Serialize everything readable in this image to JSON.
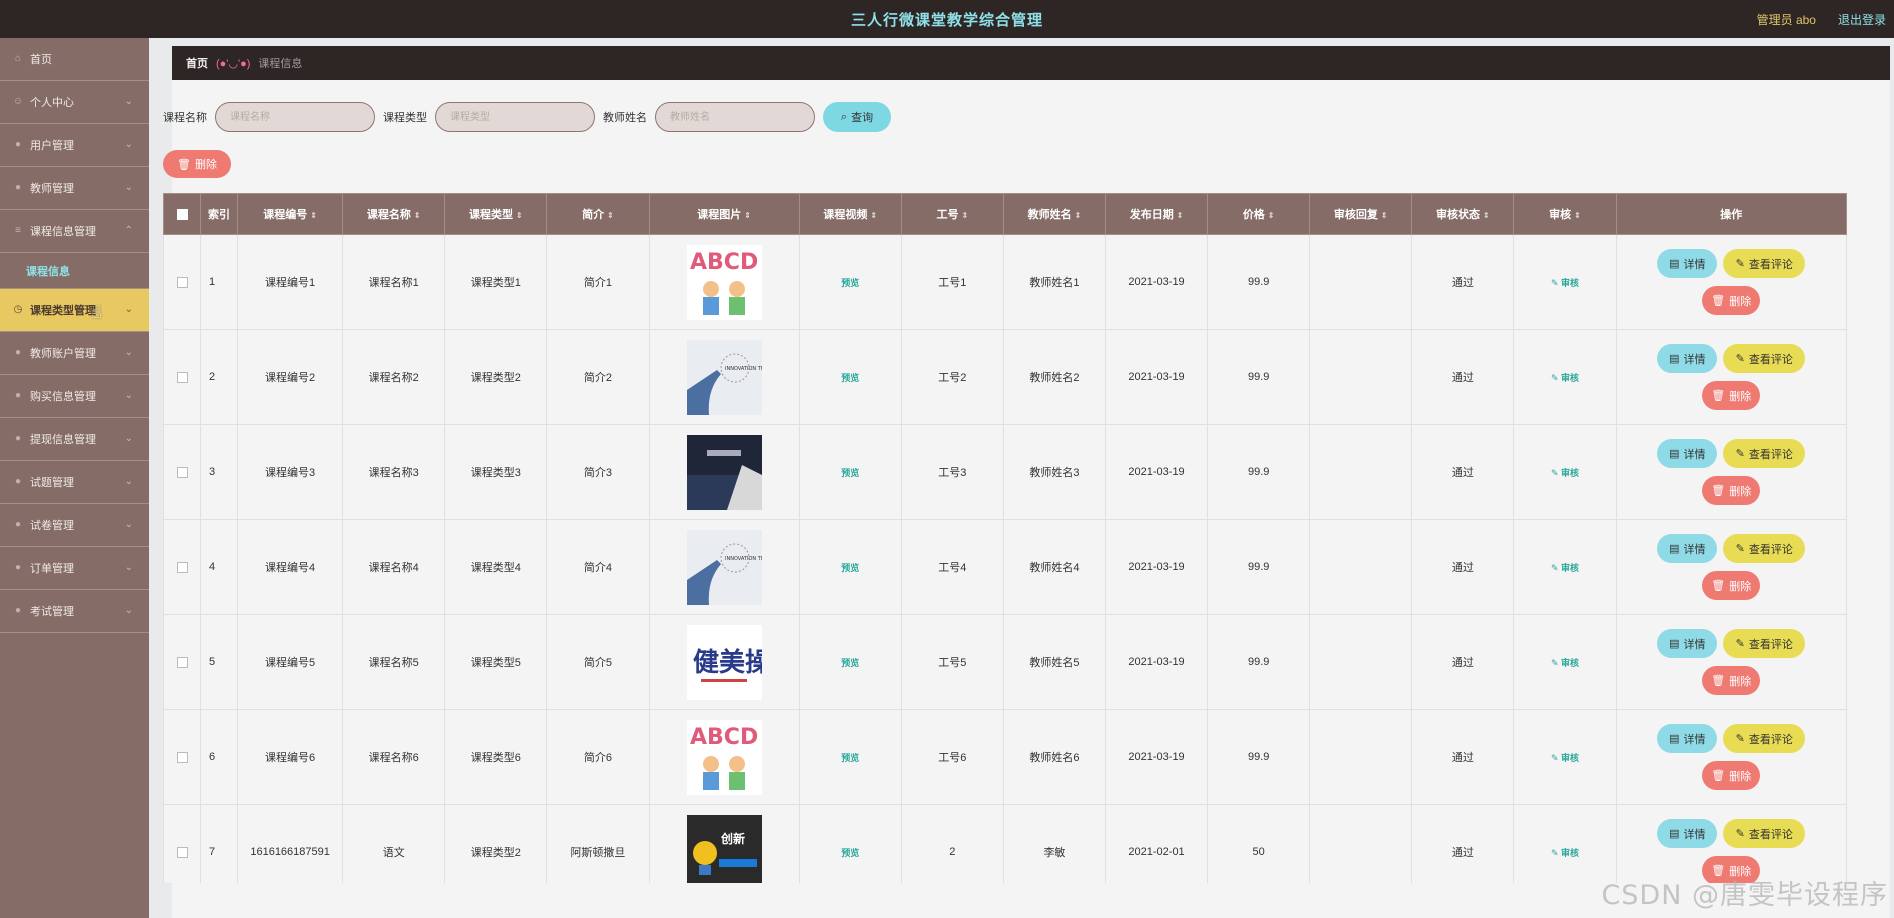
{
  "header": {
    "title": "三人行微课堂教学综合管理",
    "user_label": "管理员 abo",
    "logout_label": "退出登录"
  },
  "sidebar": {
    "items": [
      {
        "label": "首页",
        "icon": "home-icon"
      },
      {
        "label": "个人中心",
        "icon": "user-icon"
      },
      {
        "label": "用户管理",
        "icon": "users-icon"
      },
      {
        "label": "教师管理",
        "icon": "teacher-icon"
      },
      {
        "label": "课程信息管理",
        "icon": "course-icon"
      },
      {
        "label": "课程类型管理",
        "icon": "clock-icon"
      },
      {
        "label": "教师账户管理",
        "icon": "account-icon"
      },
      {
        "label": "购买信息管理",
        "icon": "cart-icon"
      },
      {
        "label": "提现信息管理",
        "icon": "wallet-icon"
      },
      {
        "label": "试题管理",
        "icon": "question-icon"
      },
      {
        "label": "试卷管理",
        "icon": "paper-icon"
      },
      {
        "label": "订单管理",
        "icon": "order-icon"
      },
      {
        "label": "考试管理",
        "icon": "exam-icon"
      }
    ],
    "sub_item": "课程信息",
    "active_color": "#e8c860"
  },
  "breadcrumb": {
    "home": "首页",
    "separator": "(●'◡'●)",
    "current": "课程信息"
  },
  "search": {
    "course_name_label": "课程名称",
    "course_name_placeholder": "课程名称",
    "course_type_label": "课程类型",
    "course_type_placeholder": "课程类型",
    "teacher_name_label": "教师姓名",
    "teacher_name_placeholder": "教师姓名",
    "query_label": "查询"
  },
  "batch_delete_label": "删除",
  "table": {
    "columns": [
      "索引",
      "课程编号",
      "课程名称",
      "课程类型",
      "简介",
      "课程图片",
      "课程视频",
      "工号",
      "教师姓名",
      "发布日期",
      "价格",
      "审核回复",
      "审核状态",
      "审核",
      "操作"
    ],
    "rows": [
      {
        "idx": "1",
        "code": "课程编号1",
        "name": "课程名称1",
        "type": "课程类型1",
        "intro": "简介1",
        "image": "abcd",
        "video": "预览",
        "job_no": "工号1",
        "teacher": "教师姓名1",
        "date": "2021-03-19",
        "price": "99.9",
        "reply": "",
        "status": "通过",
        "audit": "审核"
      },
      {
        "idx": "2",
        "code": "课程编号2",
        "name": "课程名称2",
        "type": "课程类型2",
        "intro": "简介2",
        "image": "hand",
        "video": "预览",
        "job_no": "工号2",
        "teacher": "教师姓名2",
        "date": "2021-03-19",
        "price": "99.9",
        "reply": "",
        "status": "通过",
        "audit": "审核"
      },
      {
        "idx": "3",
        "code": "课程编号3",
        "name": "课程名称3",
        "type": "课程类型3",
        "intro": "简介3",
        "image": "dark",
        "video": "预览",
        "job_no": "工号3",
        "teacher": "教师姓名3",
        "date": "2021-03-19",
        "price": "99.9",
        "reply": "",
        "status": "通过",
        "audit": "审核"
      },
      {
        "idx": "4",
        "code": "课程编号4",
        "name": "课程名称4",
        "type": "课程类型4",
        "intro": "简介4",
        "image": "hand",
        "video": "预览",
        "job_no": "工号4",
        "teacher": "教师姓名4",
        "date": "2021-03-19",
        "price": "99.9",
        "reply": "",
        "status": "通过",
        "audit": "审核"
      },
      {
        "idx": "5",
        "code": "课程编号5",
        "name": "课程名称5",
        "type": "课程类型5",
        "intro": "简介5",
        "image": "calligraphy",
        "video": "预览",
        "job_no": "工号5",
        "teacher": "教师姓名5",
        "date": "2021-03-19",
        "price": "99.9",
        "reply": "",
        "status": "通过",
        "audit": "审核"
      },
      {
        "idx": "6",
        "code": "课程编号6",
        "name": "课程名称6",
        "type": "课程类型6",
        "intro": "简介6",
        "image": "abcd",
        "video": "预览",
        "job_no": "工号6",
        "teacher": "教师姓名6",
        "date": "2021-03-19",
        "price": "99.9",
        "reply": "",
        "status": "通过",
        "audit": "审核"
      },
      {
        "idx": "7",
        "code": "1616166187591",
        "name": "语文",
        "type": "课程类型2",
        "intro": "阿斯顿撒旦",
        "image": "innovate",
        "video": "预览",
        "job_no": "2",
        "teacher": "李敏",
        "date": "2021-02-01",
        "price": "50",
        "reply": "",
        "status": "通过",
        "audit": "审核"
      }
    ],
    "op_detail": "详情",
    "op_comment": "查看评论",
    "op_delete": "删除"
  },
  "image_text": {
    "abcd_letters": "ABCD",
    "hand_text": "INNOVATION THINKING",
    "calligraphy_text": "健美操",
    "innovate_text": "创新"
  },
  "watermark": "CSDN @唐雯毕设程序"
}
